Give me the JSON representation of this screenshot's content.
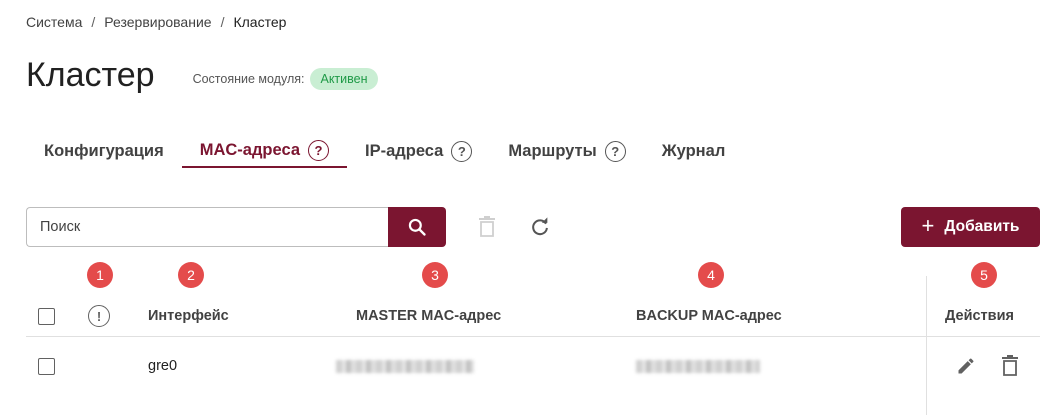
{
  "breadcrumb": {
    "items": [
      "Система",
      "Резервирование",
      "Кластер"
    ],
    "separator": "/"
  },
  "page": {
    "title": "Кластер",
    "module_state_label": "Состояние модуля:",
    "module_state_value": "Активен"
  },
  "tabs": [
    {
      "label": "Конфигурация",
      "help": false,
      "active": false
    },
    {
      "label": "MAC-адреса",
      "help": true,
      "active": true
    },
    {
      "label": "IP-адреса",
      "help": true,
      "active": false
    },
    {
      "label": "Маршруты",
      "help": true,
      "active": false
    },
    {
      "label": "Журнал",
      "help": false,
      "active": false
    }
  ],
  "toolbar": {
    "search_placeholder": "Поиск",
    "add_label": "Добавить",
    "icons": [
      "search-icon",
      "trash-icon",
      "refresh-icon",
      "plus-icon"
    ]
  },
  "markers": [
    "1",
    "2",
    "3",
    "4",
    "5"
  ],
  "table": {
    "columns": {
      "interface": "Интерфейс",
      "master": "MASTER MAC-адрес",
      "backup": "BACKUP MAC-адрес",
      "actions": "Действия"
    },
    "rows": [
      {
        "interface": "gre0"
      }
    ]
  },
  "colors": {
    "accent": "#7b1530",
    "status_bg": "#c9eed3",
    "status_text": "#1f9a47",
    "marker": "#e44b4b"
  }
}
